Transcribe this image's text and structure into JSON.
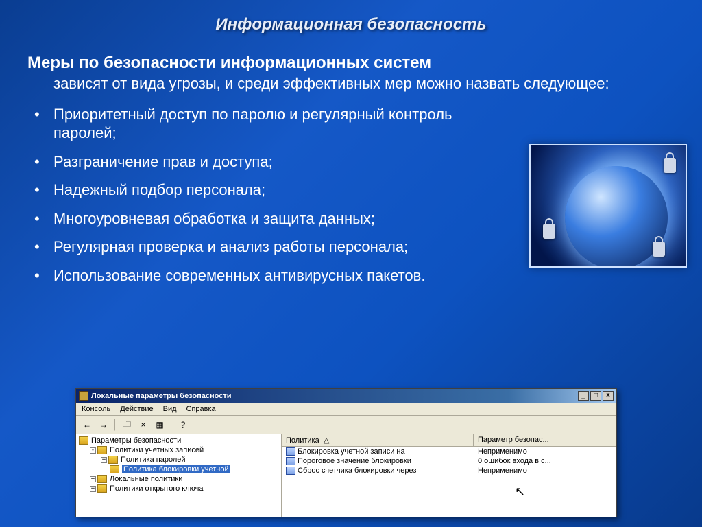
{
  "title": "Информационная безопасность",
  "heading": "Меры по безопасности информационных систем",
  "intro": "зависят от вида угрозы, и среди эффективных мер можно назвать следующее:",
  "bullets": [
    "Приоритетный доступ по паролю и регулярный контроль паролей;",
    "Разграничение прав и доступа;",
    "Надежный подбор персонала;",
    "Многоуровневая обработка и защита данных;",
    "Регулярная проверка и анализ работы персонала;",
    "Использование современных антивирусных пакетов."
  ],
  "win": {
    "title": "Локальные параметры безопасности",
    "btns": {
      "min": "_",
      "max": "□",
      "close": "X"
    },
    "menu": [
      "Консоль",
      "Действие",
      "Вид",
      "Справка"
    ],
    "tree": [
      {
        "level": 0,
        "exp": "",
        "label": "Параметры безопасности"
      },
      {
        "level": 1,
        "exp": "-",
        "label": "Политики учетных записей"
      },
      {
        "level": 2,
        "exp": "+",
        "label": "Политика паролей"
      },
      {
        "level": 2,
        "exp": "",
        "label": "Политика блокировки учетной",
        "selected": true
      },
      {
        "level": 1,
        "exp": "+",
        "label": "Локальные политики"
      },
      {
        "level": 1,
        "exp": "+",
        "label": "Политики открытого ключа"
      }
    ],
    "columns": [
      "Политика",
      "Параметр безопас..."
    ],
    "rows": [
      {
        "name": "Блокировка учетной записи на",
        "value": "Неприменимо"
      },
      {
        "name": "Пороговое значение блокировки",
        "value": "0 ошибок входа в с..."
      },
      {
        "name": "Сброс счетчика блокировки через",
        "value": "Неприменимо"
      }
    ]
  }
}
